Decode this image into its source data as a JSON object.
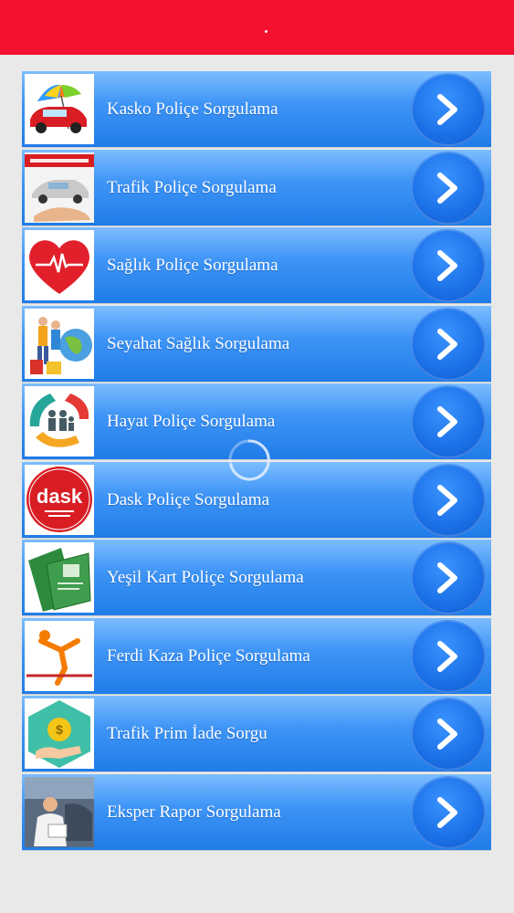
{
  "colors": {
    "header": "#f3112f",
    "row": "#3f95f6",
    "button": "#1a6fe6"
  },
  "items": [
    {
      "label": "Kasko Poliçe Sorgulama",
      "icon": "car-umbrella-icon"
    },
    {
      "label": "Trafik Poliçe Sorgulama",
      "icon": "traffic-insurance-icon"
    },
    {
      "label": "Sağlık Poliçe Sorgulama",
      "icon": "heart-pulse-icon"
    },
    {
      "label": "Seyahat Sağlık Sorgulama",
      "icon": "family-travel-icon"
    },
    {
      "label": "Hayat Poliçe Sorgulama",
      "icon": "family-hands-icon"
    },
    {
      "label": "Dask Poliçe Sorgulama",
      "icon": "dask-logo-icon",
      "logo_text": "dask"
    },
    {
      "label": "Yeşil Kart Poliçe Sorgulama",
      "icon": "green-card-icon"
    },
    {
      "label": "Ferdi Kaza Poliçe Sorgulama",
      "icon": "accident-fall-icon"
    },
    {
      "label": "Trafik Prim İade Sorgu",
      "icon": "money-refund-icon"
    },
    {
      "label": "Eksper Rapor Sorgulama",
      "icon": "expert-report-icon"
    }
  ],
  "loading_icon": "loading-spinner-icon"
}
